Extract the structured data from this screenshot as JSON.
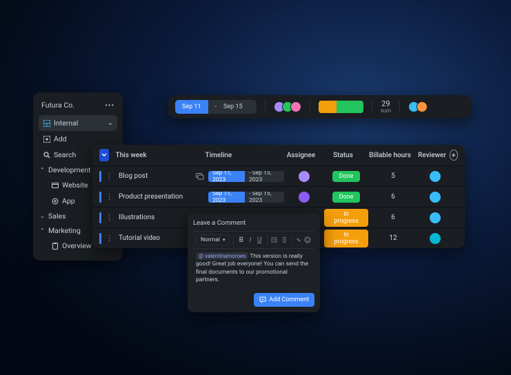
{
  "sidebar": {
    "workspace": "Futura Co.",
    "selected": "Internal",
    "nav": {
      "add": "Add",
      "search": "Search"
    },
    "groups": [
      {
        "label": "Development",
        "open": true,
        "items": [
          "Website",
          "App"
        ]
      },
      {
        "label": "Sales",
        "open": false,
        "items": []
      },
      {
        "label": "Marketing",
        "open": true,
        "items": [
          "Overview"
        ]
      }
    ]
  },
  "summary": {
    "date_start": "Sep 11",
    "date_end": "Sep 15",
    "progress": {
      "in_progress_pct": 40,
      "done_pct": 60
    },
    "hours_value": "29",
    "hours_label": "sum",
    "assignee_colors": [
      "#a78bfa",
      "#22c55e",
      "#f472b6"
    ],
    "reviewer_colors": [
      "#38bdf8",
      "#fb923c"
    ]
  },
  "table": {
    "section": "This week",
    "columns": {
      "timeline": "Timeline",
      "assignee": "Assignee",
      "status": "Status",
      "billable": "Billable hours",
      "reviewer": "Reviewer"
    },
    "rows": [
      {
        "name": "Blog post",
        "has_comments": true,
        "start": "Sep 11, 2023",
        "end": "Sep 15, 2023",
        "assignee": "#a78bfa",
        "status": "Done",
        "status_kind": "done",
        "hours": "5",
        "reviewer": "#38bdf8"
      },
      {
        "name": "Product presentation",
        "has_comments": false,
        "start": "Sep 11, 2023",
        "end": "Sep 15, 2023",
        "assignee": "#8b5cf6",
        "status": "Done",
        "status_kind": "done",
        "hours": "6",
        "reviewer": "#38bdf8"
      },
      {
        "name": "Illustrations",
        "has_comments": false,
        "start": "",
        "end": "",
        "assignee": "",
        "status": "In progress",
        "status_kind": "prog",
        "hours": "6",
        "reviewer": "#38bdf8"
      },
      {
        "name": "Tutorial video",
        "has_comments": false,
        "start": "",
        "end": "",
        "assignee": "",
        "status": "In progress",
        "status_kind": "prog",
        "hours": "12",
        "reviewer": "#06b6d4"
      }
    ]
  },
  "comment": {
    "title": "Leave a Comment",
    "format": "Normal",
    "mention": "@ valentinamoroes",
    "text": "This version is really good! Great job everyone! You can send the final documents to our promotional partners.",
    "button": "Add Comment"
  },
  "colors": {
    "primary": "#3b82f6",
    "panel": "#1a1d21",
    "done": "#22c55e",
    "progress": "#f59e0b"
  }
}
